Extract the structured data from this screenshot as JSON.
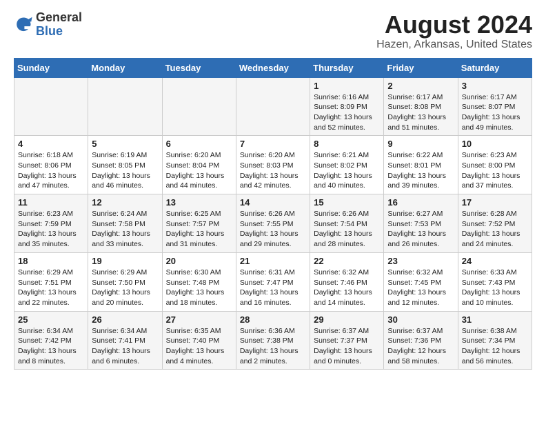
{
  "logo": {
    "general": "General",
    "blue": "Blue"
  },
  "title": "August 2024",
  "subtitle": "Hazen, Arkansas, United States",
  "days_of_week": [
    "Sunday",
    "Monday",
    "Tuesday",
    "Wednesday",
    "Thursday",
    "Friday",
    "Saturday"
  ],
  "weeks": [
    [
      {
        "day": "",
        "info": ""
      },
      {
        "day": "",
        "info": ""
      },
      {
        "day": "",
        "info": ""
      },
      {
        "day": "",
        "info": ""
      },
      {
        "day": "1",
        "info": "Sunrise: 6:16 AM\nSunset: 8:09 PM\nDaylight: 13 hours\nand 52 minutes."
      },
      {
        "day": "2",
        "info": "Sunrise: 6:17 AM\nSunset: 8:08 PM\nDaylight: 13 hours\nand 51 minutes."
      },
      {
        "day": "3",
        "info": "Sunrise: 6:17 AM\nSunset: 8:07 PM\nDaylight: 13 hours\nand 49 minutes."
      }
    ],
    [
      {
        "day": "4",
        "info": "Sunrise: 6:18 AM\nSunset: 8:06 PM\nDaylight: 13 hours\nand 47 minutes."
      },
      {
        "day": "5",
        "info": "Sunrise: 6:19 AM\nSunset: 8:05 PM\nDaylight: 13 hours\nand 46 minutes."
      },
      {
        "day": "6",
        "info": "Sunrise: 6:20 AM\nSunset: 8:04 PM\nDaylight: 13 hours\nand 44 minutes."
      },
      {
        "day": "7",
        "info": "Sunrise: 6:20 AM\nSunset: 8:03 PM\nDaylight: 13 hours\nand 42 minutes."
      },
      {
        "day": "8",
        "info": "Sunrise: 6:21 AM\nSunset: 8:02 PM\nDaylight: 13 hours\nand 40 minutes."
      },
      {
        "day": "9",
        "info": "Sunrise: 6:22 AM\nSunset: 8:01 PM\nDaylight: 13 hours\nand 39 minutes."
      },
      {
        "day": "10",
        "info": "Sunrise: 6:23 AM\nSunset: 8:00 PM\nDaylight: 13 hours\nand 37 minutes."
      }
    ],
    [
      {
        "day": "11",
        "info": "Sunrise: 6:23 AM\nSunset: 7:59 PM\nDaylight: 13 hours\nand 35 minutes."
      },
      {
        "day": "12",
        "info": "Sunrise: 6:24 AM\nSunset: 7:58 PM\nDaylight: 13 hours\nand 33 minutes."
      },
      {
        "day": "13",
        "info": "Sunrise: 6:25 AM\nSunset: 7:57 PM\nDaylight: 13 hours\nand 31 minutes."
      },
      {
        "day": "14",
        "info": "Sunrise: 6:26 AM\nSunset: 7:55 PM\nDaylight: 13 hours\nand 29 minutes."
      },
      {
        "day": "15",
        "info": "Sunrise: 6:26 AM\nSunset: 7:54 PM\nDaylight: 13 hours\nand 28 minutes."
      },
      {
        "day": "16",
        "info": "Sunrise: 6:27 AM\nSunset: 7:53 PM\nDaylight: 13 hours\nand 26 minutes."
      },
      {
        "day": "17",
        "info": "Sunrise: 6:28 AM\nSunset: 7:52 PM\nDaylight: 13 hours\nand 24 minutes."
      }
    ],
    [
      {
        "day": "18",
        "info": "Sunrise: 6:29 AM\nSunset: 7:51 PM\nDaylight: 13 hours\nand 22 minutes."
      },
      {
        "day": "19",
        "info": "Sunrise: 6:29 AM\nSunset: 7:50 PM\nDaylight: 13 hours\nand 20 minutes."
      },
      {
        "day": "20",
        "info": "Sunrise: 6:30 AM\nSunset: 7:48 PM\nDaylight: 13 hours\nand 18 minutes."
      },
      {
        "day": "21",
        "info": "Sunrise: 6:31 AM\nSunset: 7:47 PM\nDaylight: 13 hours\nand 16 minutes."
      },
      {
        "day": "22",
        "info": "Sunrise: 6:32 AM\nSunset: 7:46 PM\nDaylight: 13 hours\nand 14 minutes."
      },
      {
        "day": "23",
        "info": "Sunrise: 6:32 AM\nSunset: 7:45 PM\nDaylight: 13 hours\nand 12 minutes."
      },
      {
        "day": "24",
        "info": "Sunrise: 6:33 AM\nSunset: 7:43 PM\nDaylight: 13 hours\nand 10 minutes."
      }
    ],
    [
      {
        "day": "25",
        "info": "Sunrise: 6:34 AM\nSunset: 7:42 PM\nDaylight: 13 hours\nand 8 minutes."
      },
      {
        "day": "26",
        "info": "Sunrise: 6:34 AM\nSunset: 7:41 PM\nDaylight: 13 hours\nand 6 minutes."
      },
      {
        "day": "27",
        "info": "Sunrise: 6:35 AM\nSunset: 7:40 PM\nDaylight: 13 hours\nand 4 minutes."
      },
      {
        "day": "28",
        "info": "Sunrise: 6:36 AM\nSunset: 7:38 PM\nDaylight: 13 hours\nand 2 minutes."
      },
      {
        "day": "29",
        "info": "Sunrise: 6:37 AM\nSunset: 7:37 PM\nDaylight: 13 hours\nand 0 minutes."
      },
      {
        "day": "30",
        "info": "Sunrise: 6:37 AM\nSunset: 7:36 PM\nDaylight: 12 hours\nand 58 minutes."
      },
      {
        "day": "31",
        "info": "Sunrise: 6:38 AM\nSunset: 7:34 PM\nDaylight: 12 hours\nand 56 minutes."
      }
    ]
  ]
}
